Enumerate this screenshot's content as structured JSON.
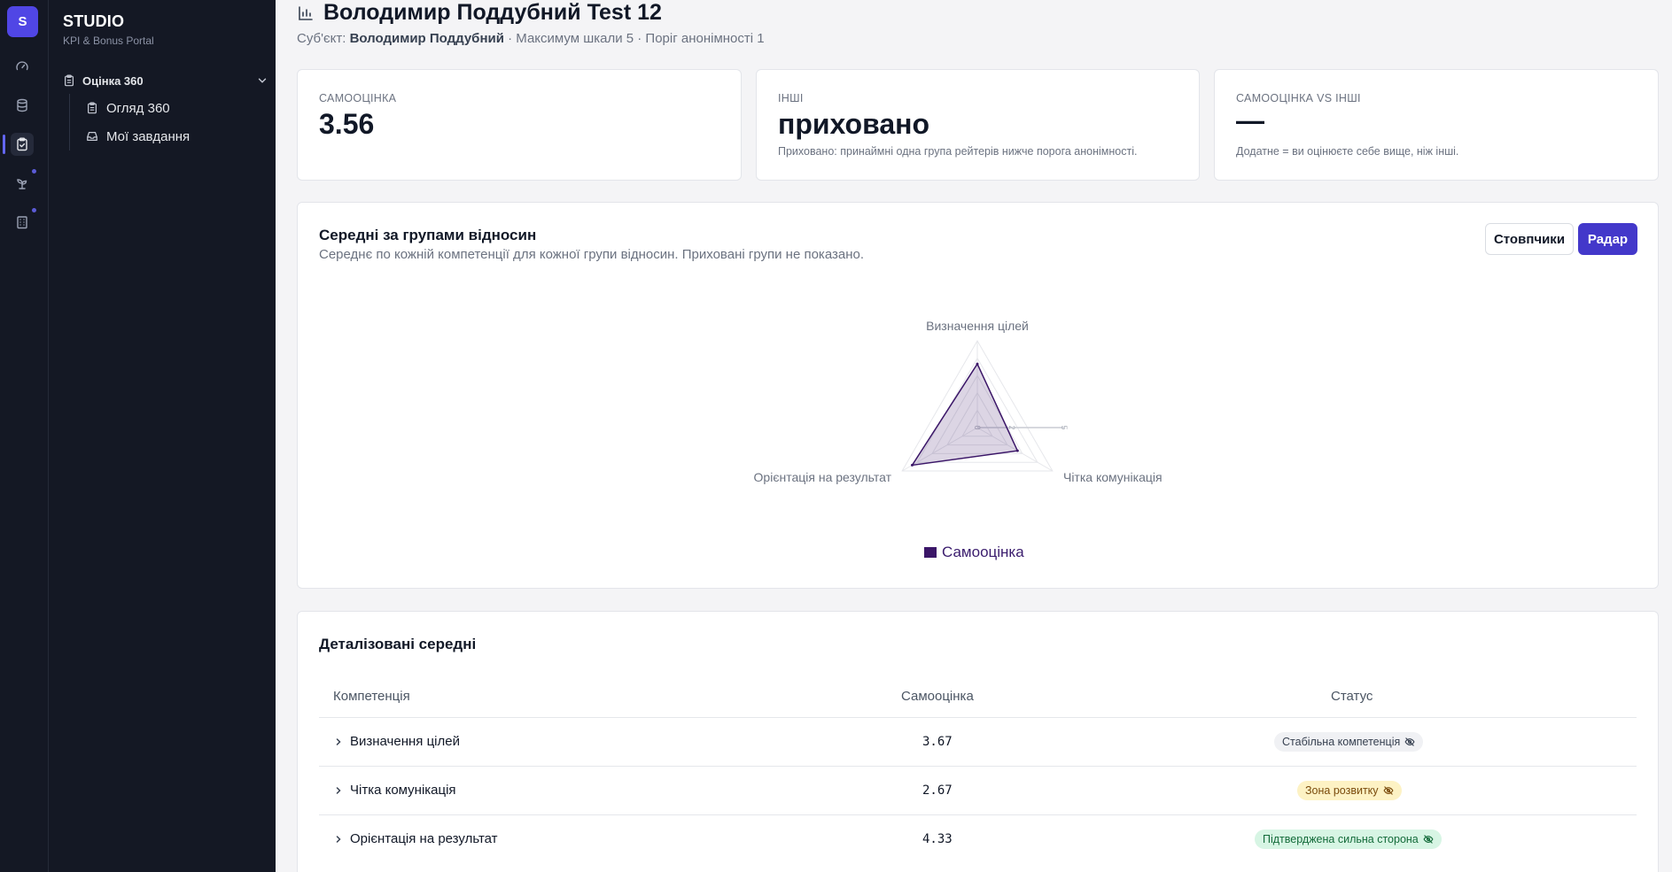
{
  "brand": {
    "logo_letter": "S",
    "name": "STUDIO",
    "subtitle": "KPI & Bonus Portal"
  },
  "rail": {
    "icons": [
      "gauge-icon",
      "database-icon",
      "clipboard-check-icon",
      "plant-icon",
      "building-icon"
    ],
    "active": "clipboard-check-icon"
  },
  "sidebar": {
    "group": {
      "label": "Оцінка 360",
      "icon": "clipboard-icon"
    },
    "items": [
      {
        "label": "Огляд 360",
        "icon": "clipboard-icon"
      },
      {
        "label": "Мої завдання",
        "icon": "inbox-icon"
      }
    ]
  },
  "header": {
    "title": "Володимир Поддубний Test 12",
    "subject_prefix": "Суб'єкт:",
    "subject_name": "Володимир Поддубний",
    "meta": "· Максимум шкали 5 · Поріг анонімності 1"
  },
  "kpis": [
    {
      "label": "САМООЦІНКА",
      "value": "3.56",
      "note": ""
    },
    {
      "label": "ІНШІ",
      "value": "приховано",
      "note": "Приховано: принаймні одна група рейтерів нижче порога анонімності."
    },
    {
      "label": "САМООЦІНКА VS ІНШІ",
      "value": "—",
      "note": "Додатне = ви оцінюєте себе вище, ніж інші."
    }
  ],
  "group_avg": {
    "title": "Середні за групами відносин",
    "description": "Середнє по кожній компетенції для кожної групи відносин. Приховані групи не показано.",
    "btn_bars": "Стовпчики",
    "btn_radar": "Радар",
    "active_view": "Радар"
  },
  "chart_data": {
    "type": "radar",
    "categories": [
      "Визначення цілей",
      "Чітка комунікація",
      "Орієнтація на результат"
    ],
    "series": [
      {
        "name": "Самооцінка",
        "values": [
          3.67,
          2.67,
          4.33
        ],
        "color": "#3b1668"
      }
    ],
    "rlim": [
      0,
      5
    ],
    "tick_labels": [
      "0",
      "2",
      "5"
    ],
    "legend": "bottom"
  },
  "details": {
    "title": "Деталізовані середні",
    "columns": [
      "Компетенція",
      "Самооцінка",
      "Статус"
    ],
    "rows": [
      {
        "name": "Визначення цілей",
        "score": "3.67",
        "status": "Стабільна компетенція",
        "status_kind": "neutral"
      },
      {
        "name": "Чітка комунікація",
        "score": "2.67",
        "status": "Зона розвитку",
        "status_kind": "warn"
      },
      {
        "name": "Орієнтація на результат",
        "score": "4.33",
        "status": "Підтверджена сильна сторона",
        "status_kind": "good"
      }
    ]
  }
}
